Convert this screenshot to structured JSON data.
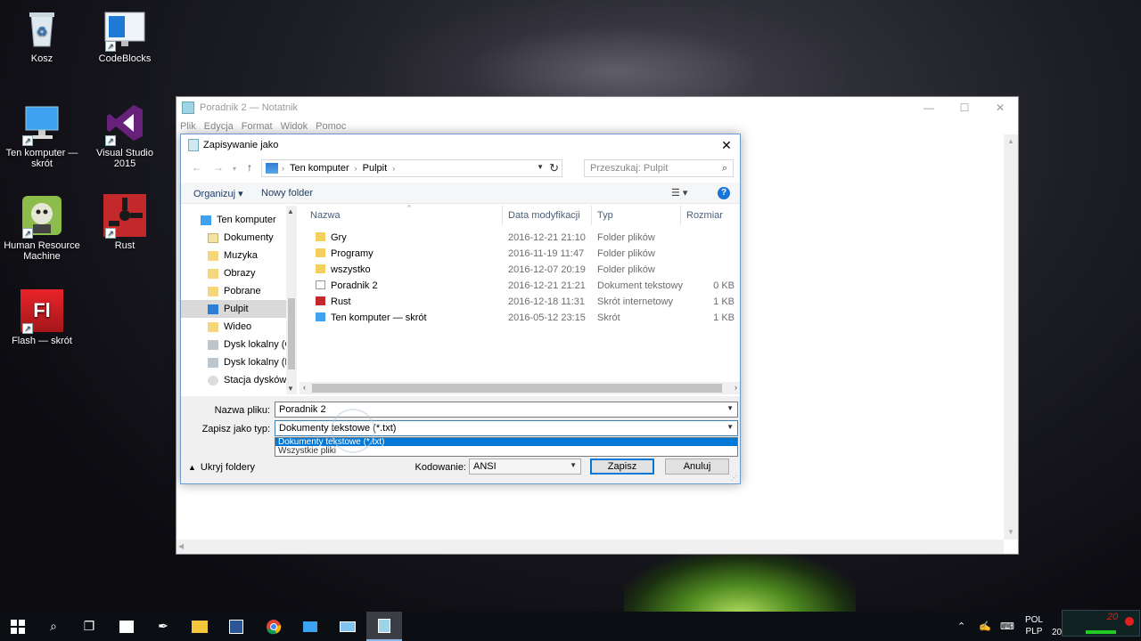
{
  "desktop": {
    "icons": [
      {
        "label": "Kosz",
        "icon": "recycle-bin-icon"
      },
      {
        "label": "CodeBlocks",
        "icon": "codeblocks-icon"
      },
      {
        "label": "Ten komputer — skrót",
        "icon": "computer-icon"
      },
      {
        "label": "Visual Studio 2015",
        "icon": "visual-studio-icon"
      },
      {
        "label": "Human Resource Machine",
        "icon": "hrm-icon"
      },
      {
        "label": "Rust",
        "icon": "rust-icon"
      },
      {
        "label": "Flash — skrót",
        "icon": "flash-icon"
      }
    ],
    "flash_glyph": "Fl"
  },
  "notepad": {
    "title": "Poradnik 2 — Notatnik",
    "menu": [
      "Plik",
      "Edycja",
      "Format",
      "Widok",
      "Pomoc"
    ]
  },
  "dialog": {
    "title": "Zapisywanie jako",
    "address": {
      "crumbs": [
        "Ten komputer",
        "Pulpit"
      ]
    },
    "search_placeholder": "Przeszukaj: Pulpit",
    "toolbar": {
      "organize": "Organizuj ▾",
      "new_folder": "Nowy folder"
    },
    "nav": [
      {
        "label": "Ten komputer",
        "icon": "computer-icon",
        "selected": false,
        "indent": 0
      },
      {
        "label": "Dokumenty",
        "icon": "documents-icon",
        "selected": false,
        "indent": 1
      },
      {
        "label": "Muzyka",
        "icon": "music-icon",
        "selected": false,
        "indent": 1
      },
      {
        "label": "Obrazy",
        "icon": "pictures-icon",
        "selected": false,
        "indent": 1
      },
      {
        "label": "Pobrane",
        "icon": "downloads-icon",
        "selected": false,
        "indent": 1
      },
      {
        "label": "Pulpit",
        "icon": "desktop-icon",
        "selected": true,
        "indent": 1
      },
      {
        "label": "Wideo",
        "icon": "video-icon",
        "selected": false,
        "indent": 1
      },
      {
        "label": "Dysk lokalny (C:)",
        "icon": "drive-icon",
        "selected": false,
        "indent": 1
      },
      {
        "label": "Dysk lokalny (D:)",
        "icon": "drive-icon",
        "selected": false,
        "indent": 1
      },
      {
        "label": "Stacja dysków D",
        "icon": "disc-drive-icon",
        "selected": false,
        "indent": 1
      }
    ],
    "columns": {
      "name": "Nazwa",
      "date": "Data modyfikacji",
      "type": "Typ",
      "size": "Rozmiar"
    },
    "files": [
      {
        "name": "Gry",
        "date": "2016-12-21 21:10",
        "type": "Folder plików",
        "size": "",
        "icon": "folder-icon"
      },
      {
        "name": "Programy",
        "date": "2016-11-19 11:47",
        "type": "Folder plików",
        "size": "",
        "icon": "folder-icon"
      },
      {
        "name": "wszystko",
        "date": "2016-12-07 20:19",
        "type": "Folder plików",
        "size": "",
        "icon": "folder-icon"
      },
      {
        "name": "Poradnik 2",
        "date": "2016-12-21 21:21",
        "type": "Dokument tekstowy",
        "size": "0 KB",
        "icon": "text-file-icon"
      },
      {
        "name": "Rust",
        "date": "2016-12-18 11:31",
        "type": "Skrót internetowy",
        "size": "1 KB",
        "icon": "rust-shortcut-icon"
      },
      {
        "name": "Ten komputer — skrót",
        "date": "2016-05-12 23:15",
        "type": "Skrót",
        "size": "1 KB",
        "icon": "computer-shortcut-icon"
      }
    ],
    "filename_label": "Nazwa pliku:",
    "filename_value": "Poradnik 2",
    "filetype_label": "Zapisz jako typ:",
    "filetype_value": "Dokumenty tekstowe (*.txt)",
    "filetype_options": [
      "Dokumenty tekstowe (*.txt)",
      "Wszystkie pliki"
    ],
    "hide_folders": "Ukryj foldery",
    "encoding_label": "Kodowanie:",
    "encoding_value": "ANSI",
    "save_button": "Zapisz",
    "cancel_button": "Anuluj"
  },
  "taskbar": {
    "items": [
      "start-icon",
      "search-icon",
      "task-view-icon",
      "store-icon",
      "app-icon",
      "file-explorer-icon",
      "word-icon",
      "chrome-icon",
      "computer-icon",
      "remote-icon",
      "notepad-icon"
    ],
    "lang_line1": "POL",
    "lang_line2": "PLP",
    "clock": "20",
    "recorder_value": "20"
  }
}
